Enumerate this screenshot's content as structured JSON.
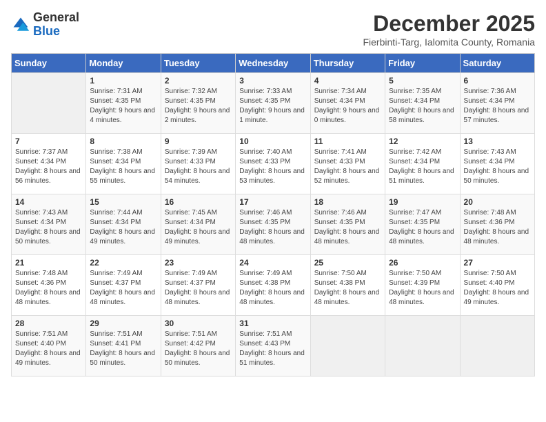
{
  "logo": {
    "text_general": "General",
    "text_blue": "Blue"
  },
  "header": {
    "month": "December 2025",
    "location": "Fierbinti-Targ, Ialomita County, Romania"
  },
  "days_of_week": [
    "Sunday",
    "Monday",
    "Tuesday",
    "Wednesday",
    "Thursday",
    "Friday",
    "Saturday"
  ],
  "weeks": [
    [
      {
        "day": "",
        "sunrise": "",
        "sunset": "",
        "daylight": ""
      },
      {
        "day": "1",
        "sunrise": "7:31 AM",
        "sunset": "4:35 PM",
        "daylight": "9 hours and 4 minutes."
      },
      {
        "day": "2",
        "sunrise": "7:32 AM",
        "sunset": "4:35 PM",
        "daylight": "9 hours and 2 minutes."
      },
      {
        "day": "3",
        "sunrise": "7:33 AM",
        "sunset": "4:35 PM",
        "daylight": "9 hours and 1 minute."
      },
      {
        "day": "4",
        "sunrise": "7:34 AM",
        "sunset": "4:34 PM",
        "daylight": "9 hours and 0 minutes."
      },
      {
        "day": "5",
        "sunrise": "7:35 AM",
        "sunset": "4:34 PM",
        "daylight": "8 hours and 58 minutes."
      },
      {
        "day": "6",
        "sunrise": "7:36 AM",
        "sunset": "4:34 PM",
        "daylight": "8 hours and 57 minutes."
      }
    ],
    [
      {
        "day": "7",
        "sunrise": "7:37 AM",
        "sunset": "4:34 PM",
        "daylight": "8 hours and 56 minutes."
      },
      {
        "day": "8",
        "sunrise": "7:38 AM",
        "sunset": "4:34 PM",
        "daylight": "8 hours and 55 minutes."
      },
      {
        "day": "9",
        "sunrise": "7:39 AM",
        "sunset": "4:33 PM",
        "daylight": "8 hours and 54 minutes."
      },
      {
        "day": "10",
        "sunrise": "7:40 AM",
        "sunset": "4:33 PM",
        "daylight": "8 hours and 53 minutes."
      },
      {
        "day": "11",
        "sunrise": "7:41 AM",
        "sunset": "4:33 PM",
        "daylight": "8 hours and 52 minutes."
      },
      {
        "day": "12",
        "sunrise": "7:42 AM",
        "sunset": "4:34 PM",
        "daylight": "8 hours and 51 minutes."
      },
      {
        "day": "13",
        "sunrise": "7:43 AM",
        "sunset": "4:34 PM",
        "daylight": "8 hours and 50 minutes."
      }
    ],
    [
      {
        "day": "14",
        "sunrise": "7:43 AM",
        "sunset": "4:34 PM",
        "daylight": "8 hours and 50 minutes."
      },
      {
        "day": "15",
        "sunrise": "7:44 AM",
        "sunset": "4:34 PM",
        "daylight": "8 hours and 49 minutes."
      },
      {
        "day": "16",
        "sunrise": "7:45 AM",
        "sunset": "4:34 PM",
        "daylight": "8 hours and 49 minutes."
      },
      {
        "day": "17",
        "sunrise": "7:46 AM",
        "sunset": "4:35 PM",
        "daylight": "8 hours and 48 minutes."
      },
      {
        "day": "18",
        "sunrise": "7:46 AM",
        "sunset": "4:35 PM",
        "daylight": "8 hours and 48 minutes."
      },
      {
        "day": "19",
        "sunrise": "7:47 AM",
        "sunset": "4:35 PM",
        "daylight": "8 hours and 48 minutes."
      },
      {
        "day": "20",
        "sunrise": "7:48 AM",
        "sunset": "4:36 PM",
        "daylight": "8 hours and 48 minutes."
      }
    ],
    [
      {
        "day": "21",
        "sunrise": "7:48 AM",
        "sunset": "4:36 PM",
        "daylight": "8 hours and 48 minutes."
      },
      {
        "day": "22",
        "sunrise": "7:49 AM",
        "sunset": "4:37 PM",
        "daylight": "8 hours and 48 minutes."
      },
      {
        "day": "23",
        "sunrise": "7:49 AM",
        "sunset": "4:37 PM",
        "daylight": "8 hours and 48 minutes."
      },
      {
        "day": "24",
        "sunrise": "7:49 AM",
        "sunset": "4:38 PM",
        "daylight": "8 hours and 48 minutes."
      },
      {
        "day": "25",
        "sunrise": "7:50 AM",
        "sunset": "4:38 PM",
        "daylight": "8 hours and 48 minutes."
      },
      {
        "day": "26",
        "sunrise": "7:50 AM",
        "sunset": "4:39 PM",
        "daylight": "8 hours and 48 minutes."
      },
      {
        "day": "27",
        "sunrise": "7:50 AM",
        "sunset": "4:40 PM",
        "daylight": "8 hours and 49 minutes."
      }
    ],
    [
      {
        "day": "28",
        "sunrise": "7:51 AM",
        "sunset": "4:40 PM",
        "daylight": "8 hours and 49 minutes."
      },
      {
        "day": "29",
        "sunrise": "7:51 AM",
        "sunset": "4:41 PM",
        "daylight": "8 hours and 50 minutes."
      },
      {
        "day": "30",
        "sunrise": "7:51 AM",
        "sunset": "4:42 PM",
        "daylight": "8 hours and 50 minutes."
      },
      {
        "day": "31",
        "sunrise": "7:51 AM",
        "sunset": "4:43 PM",
        "daylight": "8 hours and 51 minutes."
      },
      {
        "day": "",
        "sunrise": "",
        "sunset": "",
        "daylight": ""
      },
      {
        "day": "",
        "sunrise": "",
        "sunset": "",
        "daylight": ""
      },
      {
        "day": "",
        "sunrise": "",
        "sunset": "",
        "daylight": ""
      }
    ]
  ]
}
